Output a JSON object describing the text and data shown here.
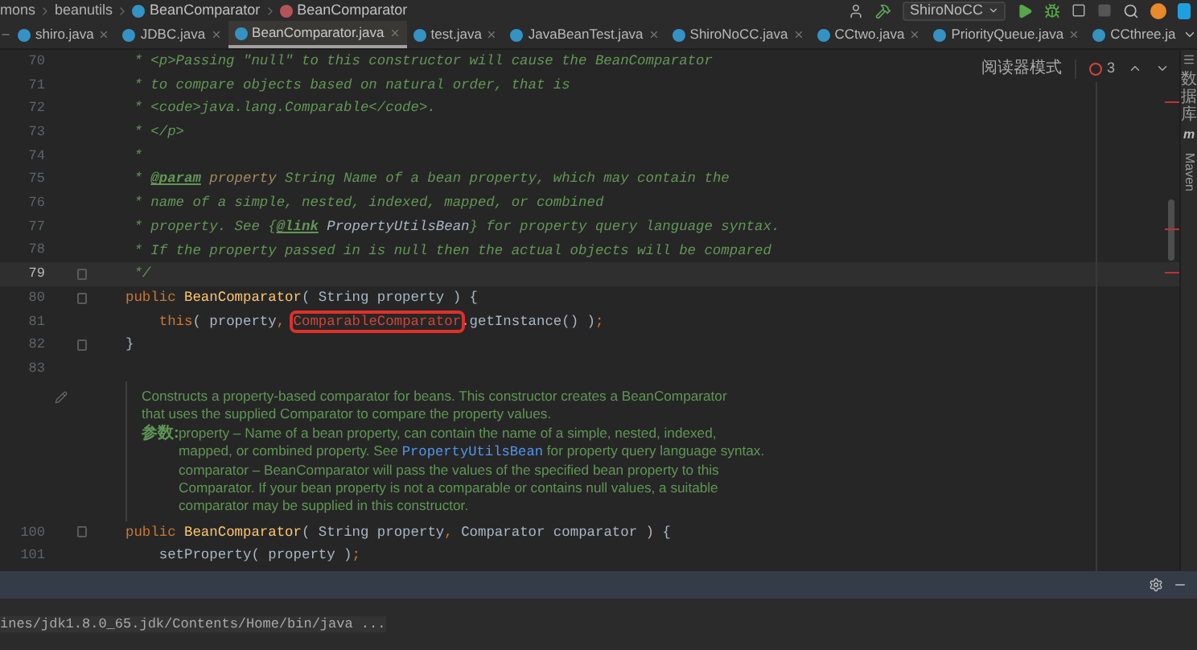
{
  "breadcrumbs": [
    {
      "label": "mons",
      "kind": "folder"
    },
    {
      "label": "beanutils",
      "kind": "folder"
    },
    {
      "label": "BeanComparator",
      "kind": "class"
    },
    {
      "label": "BeanComparator",
      "kind": "method"
    }
  ],
  "toolbar": {
    "run_config": "ShiroNoCC"
  },
  "tabs": [
    {
      "label": "shiro.java",
      "selected": false
    },
    {
      "label": "JDBC.java",
      "selected": false
    },
    {
      "label": "BeanComparator.java",
      "selected": true
    },
    {
      "label": "test.java",
      "selected": false
    },
    {
      "label": "JavaBeanTest.java",
      "selected": false
    },
    {
      "label": "ShiroNoCC.java",
      "selected": false
    },
    {
      "label": "CCtwo.java",
      "selected": false
    },
    {
      "label": "PriorityQueue.java",
      "selected": false
    },
    {
      "label": "CCthree.ja",
      "selected": false
    }
  ],
  "editor": {
    "reader_mode": "阅读器模式",
    "error_count": "3",
    "lines": [
      {
        "number": "70",
        "current": false,
        "segments": [
          {
            "kind": "comment",
            "text": " * <p>Passing \"null\" to this constructor will cause the BeanComparator"
          }
        ]
      },
      {
        "number": "71",
        "current": false,
        "segments": [
          {
            "kind": "comment",
            "text": " * to compare objects based on natural order, that is"
          }
        ]
      },
      {
        "number": "72",
        "current": false,
        "segments": [
          {
            "kind": "comment",
            "text": " * <code>java.lang.Comparable</code>."
          }
        ]
      },
      {
        "number": "73",
        "current": false,
        "segments": [
          {
            "kind": "comment",
            "text": " * </p>"
          }
        ]
      },
      {
        "number": "74",
        "current": false,
        "segments": [
          {
            "kind": "comment",
            "text": " *"
          }
        ]
      },
      {
        "number": "75",
        "current": false,
        "segments": [
          {
            "kind": "comment",
            "text": " * "
          },
          {
            "kind": "tag",
            "text": "@param"
          },
          {
            "kind": "param",
            "text": " property"
          },
          {
            "kind": "comment",
            "text": " String Name of a bean property, which may contain the"
          }
        ]
      },
      {
        "number": "76",
        "current": false,
        "segments": [
          {
            "kind": "comment",
            "text": " * name of a simple, nested, indexed, mapped, or combined"
          }
        ]
      },
      {
        "number": "77",
        "current": false,
        "segments": [
          {
            "kind": "comment",
            "text": " * property. See {"
          },
          {
            "kind": "tag",
            "text": "@link"
          },
          {
            "kind": "ref",
            "text": " PropertyUtilsBean"
          },
          {
            "kind": "comment",
            "text": "} for property query language syntax."
          }
        ]
      },
      {
        "number": "78",
        "current": false,
        "segments": [
          {
            "kind": "comment",
            "text": " * If the property passed in is null then the actual objects will be compared"
          }
        ]
      },
      {
        "number": "79",
        "current": true,
        "segments": [
          {
            "kind": "comment",
            "text": " */"
          }
        ]
      },
      {
        "number": "80",
        "current": false,
        "segments": [
          {
            "kind": "keyword",
            "text": "public "
          },
          {
            "kind": "method",
            "text": "BeanComparator"
          },
          {
            "kind": "plain",
            "text": "( String property ) {"
          }
        ]
      },
      {
        "number": "81",
        "current": false,
        "segments": [
          {
            "kind": "keyword",
            "text": "    this"
          },
          {
            "kind": "plain",
            "text": "( property"
          },
          {
            "kind": "keyword",
            "text": ", "
          },
          {
            "kind": "error",
            "text": "ComparableComparator"
          },
          {
            "kind": "plain",
            "text": ".getInstance() )"
          },
          {
            "kind": "keyword",
            "text": ";"
          }
        ]
      },
      {
        "number": "82",
        "current": false,
        "segments": [
          {
            "kind": "plain",
            "text": "}"
          }
        ]
      },
      {
        "number": "83",
        "current": false
      }
    ],
    "doc": {
      "summary": [
        "Constructs a property-based comparator for beans. This constructor creates a BeanComparator",
        "that uses the supplied Comparator to compare the property values."
      ],
      "params_label": "参数:",
      "params": [
        [
          {
            "kind": "text",
            "text": "property – Name of a bean property, can contain the name of a simple, nested, indexed,"
          }
        ],
        [
          {
            "kind": "text",
            "text": "mapped, or combined property. See "
          },
          {
            "kind": "link",
            "text": "PropertyUtilsBean"
          },
          {
            "kind": "text",
            "text": " for property query language syntax."
          }
        ],
        [
          {
            "kind": "text",
            "text": "comparator – BeanComparator will pass the values of the specified bean property to this"
          }
        ],
        [
          {
            "kind": "text",
            "text": "Comparator. If your bean property is not a comparable or contains null values, a suitable"
          }
        ],
        [
          {
            "kind": "text",
            "text": "comparator may be supplied in this constructor."
          }
        ]
      ]
    },
    "lines_after": [
      {
        "number": "100",
        "current": false,
        "segments": [
          {
            "kind": "keyword",
            "text": "public "
          },
          {
            "kind": "method",
            "text": "BeanComparator"
          },
          {
            "kind": "plain",
            "text": "( String property"
          },
          {
            "kind": "keyword",
            "text": ", "
          },
          {
            "kind": "plain",
            "text": "Comparator comparator ) {"
          }
        ]
      },
      {
        "number": "101",
        "current": false,
        "segments": [
          {
            "kind": "plain",
            "text": "    setProperty( property )"
          },
          {
            "kind": "keyword",
            "text": ";"
          }
        ]
      }
    ]
  },
  "side_strip": {
    "database": "数据库",
    "maven_icon": "m",
    "maven": "Maven"
  },
  "run_panel": {
    "output": "ines/jdk1.8.0_65.jdk/Contents/Home/bin/java ..."
  }
}
